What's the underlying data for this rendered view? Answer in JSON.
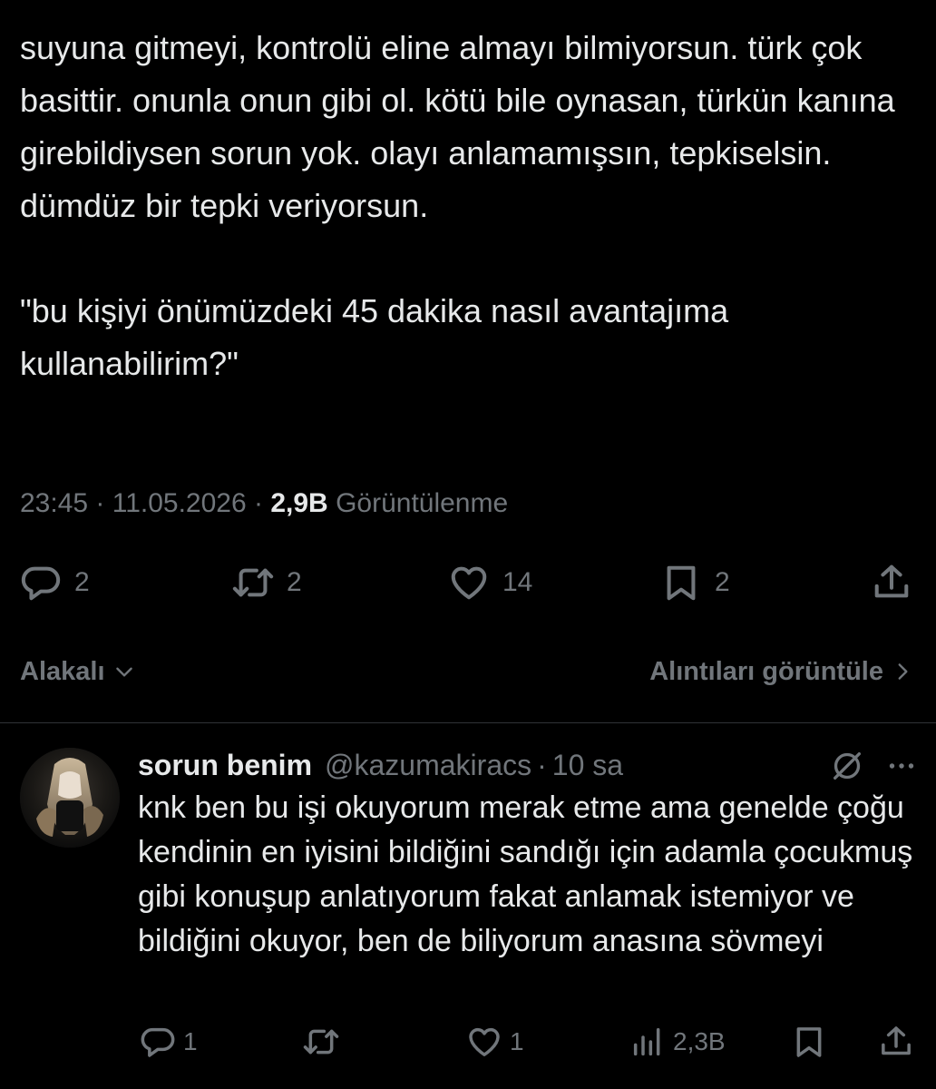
{
  "tweet": {
    "paragraphs": [
      "suyuna gitmeyi, kontrolü eline almayı bilmiyorsun. türk çok basittir. onunla onun gibi ol. kötü bile oynasan, türkün kanına girebildiysen sorun yok. olayı anlamamışsın, tepkiselsin. dümdüz bir tepki veriyorsun.",
      "\"bu kişiyi önümüzdeki 45 dakika nasıl avantajıma kullanabilirim?\""
    ],
    "time": "23:45",
    "date": "11.05.2026",
    "views_count": "2,9B",
    "views_label": "Görüntülenme",
    "actions": {
      "replies": "2",
      "reposts": "2",
      "likes": "14",
      "bookmarks": "2"
    }
  },
  "sort": {
    "label": "Alakalı",
    "quotes_link": "Alıntıları görüntüle"
  },
  "reply": {
    "name": "sorun benim",
    "handle": "@kazumakiracs",
    "time": "10 sa",
    "text": "knk ben bu işi okuyorum merak etme ama genelde çoğu kendinin en iyisini bildiğini sandığı için adamla çocukmuş gibi konuşup anlatıyorum fakat anlamak istemiyor ve bildiğini okuyor, ben de biliyorum anasına sövmeyi",
    "actions": {
      "replies": "1",
      "likes": "1",
      "views": "2,3B"
    }
  },
  "icons": {
    "reply": "speech-bubble-icon",
    "repost": "repost-arrows-icon",
    "like": "heart-icon",
    "bookmark": "bookmark-icon",
    "share": "share-upload-icon",
    "views": "bar-chart-icon",
    "grok": "slashed-circle-icon",
    "more": "more-dots-icon",
    "chevron_down": "chevron-down-icon",
    "chevron_right": "chevron-right-icon"
  },
  "colors": {
    "background": "#000000",
    "text": "#e7e9ea",
    "muted": "#71767b",
    "divider": "#2f3336"
  }
}
